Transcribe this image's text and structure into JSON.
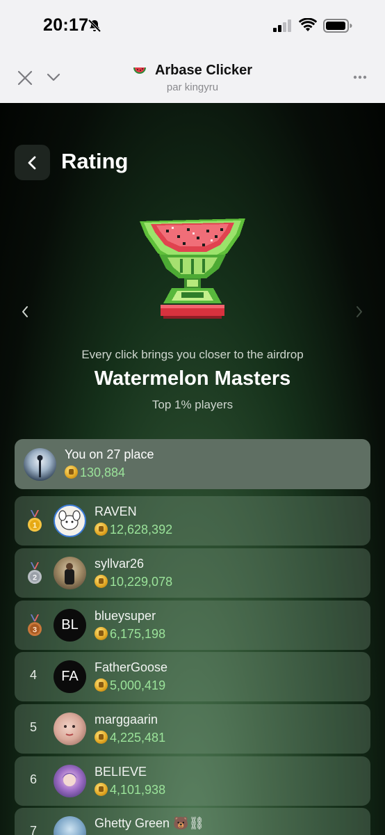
{
  "status": {
    "time": "20:17"
  },
  "app": {
    "title": "Arbase Clicker",
    "subtitle": "par kingyru"
  },
  "page": {
    "title": "Rating"
  },
  "league": {
    "tagline": "Every click brings you closer to the airdrop",
    "name": "Watermelon Masters",
    "subtitle": "Top 1% players"
  },
  "me": {
    "label": "You on 27 place",
    "score": "130,884"
  },
  "leaderboard": [
    {
      "rank": "1",
      "name": "RAVEN",
      "score": "12,628,392",
      "avatar": "image"
    },
    {
      "rank": "2",
      "name": "syllvar26",
      "score": "10,229,078",
      "avatar": "image"
    },
    {
      "rank": "3",
      "name": "blueysuper",
      "score": "6,175,198",
      "avatar": "BL"
    },
    {
      "rank": "4",
      "name": "FatherGoose",
      "score": "5,000,419",
      "avatar": "FA"
    },
    {
      "rank": "5",
      "name": "marggaarin",
      "score": "4,225,481",
      "avatar": "image"
    },
    {
      "rank": "6",
      "name": "BELIEVE",
      "score": "4,101,938",
      "avatar": "image"
    },
    {
      "rank": "7",
      "name": "Ghetty Green 🐻⛓",
      "score": "",
      "avatar": "image"
    }
  ],
  "colors": {
    "score": "#9be39a",
    "medal_gold": "#f5c542",
    "medal_silver": "#b9bec4",
    "medal_bronze": "#c9773a"
  }
}
